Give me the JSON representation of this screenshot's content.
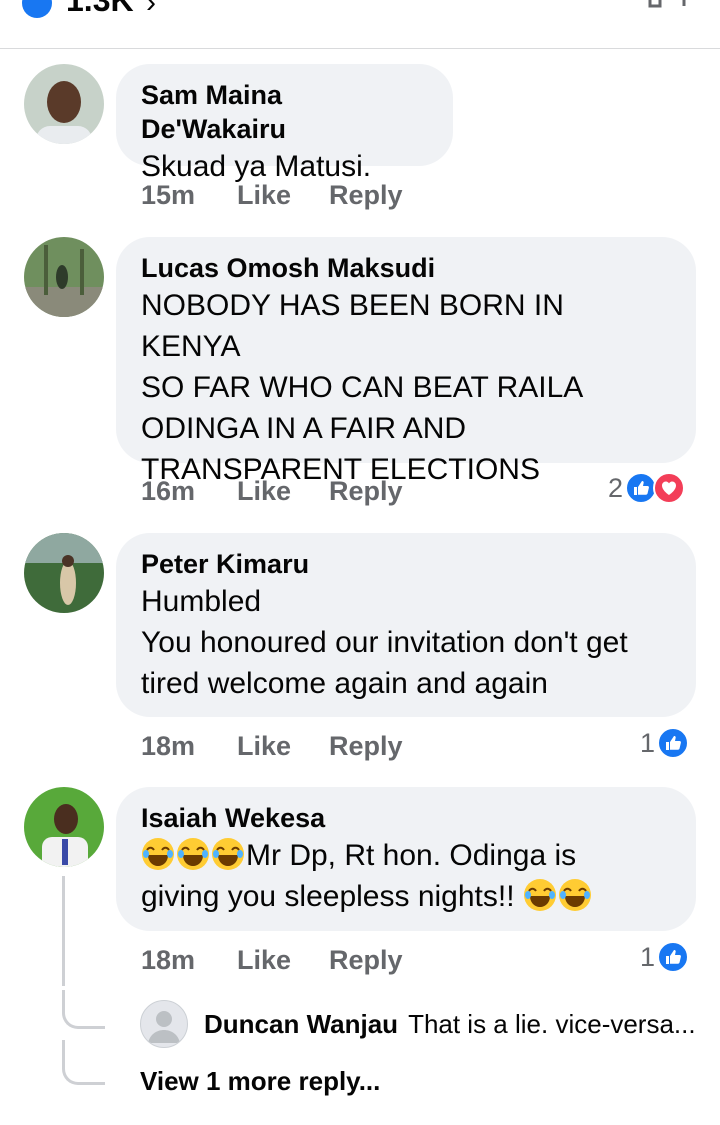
{
  "header": {
    "reaction_count": "1.3K"
  },
  "comments": [
    {
      "author": "Sam Maina De'Wakairu",
      "text": "Skuad ya Matusi.",
      "time": "15m",
      "like_label": "Like",
      "reply_label": "Reply"
    },
    {
      "author": "Lucas Omosh Maksudi",
      "text": "NOBODY HAS BEEN BORN IN KENYA\nSO FAR WHO CAN BEAT RAILA\nODINGA IN A FAIR AND\nTRANSPARENT ELECTIONS",
      "time": "16m",
      "like_label": "Like",
      "reply_label": "Reply",
      "reactions": "2"
    },
    {
      "author": "Peter Kimaru",
      "text": "Humbled\nYou honoured our invitation don't get\ntired welcome again and again",
      "time": "18m",
      "like_label": "Like",
      "reply_label": "Reply",
      "reactions": "1"
    },
    {
      "author": "Isaiah Wekesa",
      "text_part1": "Mr Dp, Rt hon. Odinga is",
      "text_part2": "giving you sleepless nights!! ",
      "time": "18m",
      "like_label": "Like",
      "reply_label": "Reply",
      "reactions": "1"
    }
  ],
  "reply_preview": {
    "author": "Duncan Wanjau",
    "snippet": "That is a lie. vice-versa..."
  },
  "view_more_replies": "View 1 more reply..."
}
